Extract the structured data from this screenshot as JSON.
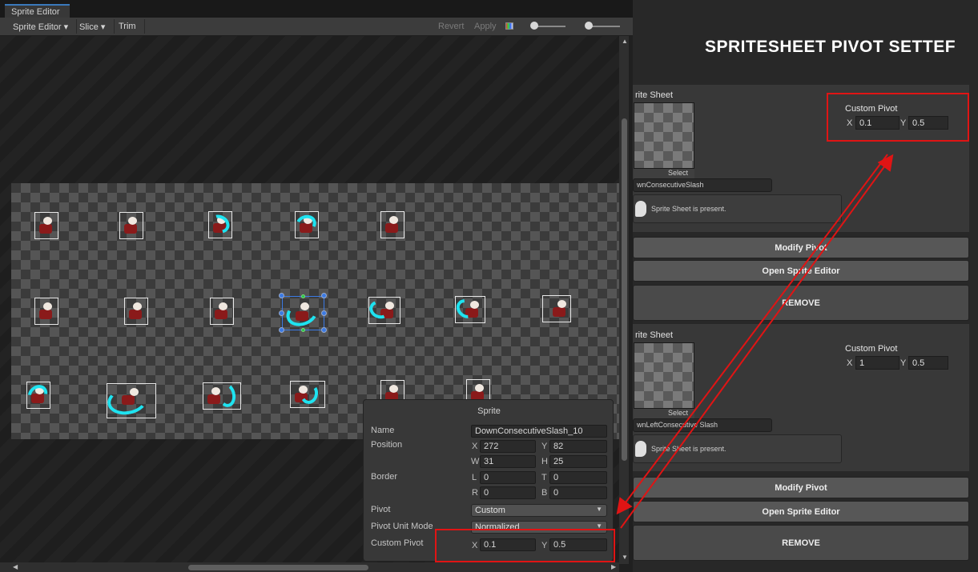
{
  "sprite_editor": {
    "tab_title": "Sprite Editor",
    "window_controls": "⋮ ▭ ✕",
    "toolbar": {
      "mode_label": "Sprite Editor ▾",
      "slice_label": "Slice ▾",
      "trim_label": "Trim",
      "revert_label": "Revert",
      "apply_label": "Apply"
    }
  },
  "sprite_panel": {
    "title": "Sprite",
    "name_label": "Name",
    "name_value": "DownConsecutiveSlash_10",
    "position_label": "Position",
    "x_axis": "X",
    "x_value": "272",
    "y_axis": "Y",
    "y_value": "82",
    "w_axis": "W",
    "w_value": "31",
    "h_axis": "H",
    "h_value": "25",
    "border_label": "Border",
    "l_axis": "L",
    "l_value": "0",
    "t_axis": "T",
    "t_value": "0",
    "r_axis": "R",
    "r_value": "0",
    "b_axis": "B",
    "b_value": "0",
    "pivot_label": "Pivot",
    "pivot_value": "Custom",
    "pivot_unit_label": "Pivot Unit Mode",
    "pivot_unit_value": "Normalized",
    "custom_pivot_label": "Custom Pivot",
    "custom_x_axis": "X",
    "custom_x_value": "0.1",
    "custom_y_axis": "Y",
    "custom_y_value": "0.5"
  },
  "pivot_setter": {
    "title": "SPRITESHEET PIVOT SETTEF",
    "entries": [
      {
        "sheet_label": "rite Sheet",
        "select_label": "Select",
        "sheet_name": "wnConsecutiveSlash",
        "help_text": "Sprite Sheet is present.",
        "pivot_label": "Custom Pivot",
        "x_axis": "X",
        "x_value": "0.1",
        "y_axis": "Y",
        "y_value": "0.5",
        "modify_label": "Modify Pivot",
        "open_label": "Open Sprite Editor",
        "remove_label": "REMOVE"
      },
      {
        "sheet_label": "rite Sheet",
        "select_label": "Select",
        "sheet_name": "wnLeftConsecutive Slash",
        "help_text": "Sprite Sheet is present.",
        "pivot_label": "Custom Pivot",
        "x_axis": "X",
        "x_value": "1",
        "y_axis": "Y",
        "y_value": "0.5",
        "modify_label": "Modify Pivot",
        "open_label": "Open Sprite Editor",
        "remove_label": "REMOVE"
      }
    ]
  },
  "colors": {
    "annotation_red": "#e01414",
    "selection_blue": "#3b7ae4",
    "slash_cyan": "#1ee3f0"
  }
}
